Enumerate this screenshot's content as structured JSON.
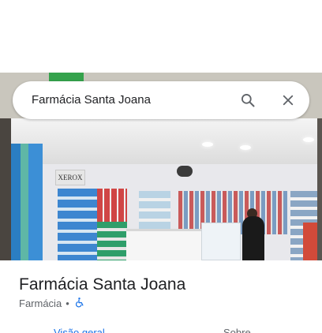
{
  "search": {
    "query": "Farmácia Santa Joana"
  },
  "photo": {
    "xerox_label": "XEROX"
  },
  "place": {
    "name": "Farmácia Santa Joana",
    "category": "Farmácia",
    "separator": "•",
    "accessibility_icon": "wheelchair-icon"
  },
  "tabs": [
    {
      "label": "Visão geral",
      "active": true
    },
    {
      "label": "Sobre",
      "active": false
    }
  ],
  "colors": {
    "accent": "#1a73e8",
    "text": "#202124",
    "secondary": "#5f6368"
  }
}
